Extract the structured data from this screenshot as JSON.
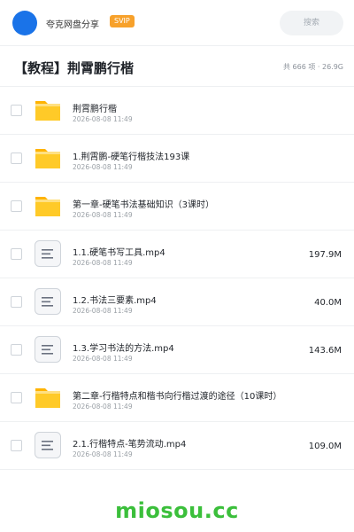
{
  "header": {
    "user_name": "夸克网盘分享",
    "badge": "SVIP",
    "search_placeholder": "搜索",
    "avatar_color": "#1a73e8"
  },
  "folder": {
    "title": "【教程】荆霄鹏行楷",
    "stats": "共 666 项 · 26.9G"
  },
  "files": [
    {
      "type": "folder",
      "icon": "folder-icon",
      "name": "荆霄鹏行楷",
      "date": "2026-08-08 11:49",
      "size": ""
    },
    {
      "type": "folder",
      "icon": "folder-icon",
      "name": "1.荆霄鹏-硬笔行楷技法193课",
      "date": "2026-08-08 11:49",
      "size": ""
    },
    {
      "type": "folder",
      "icon": "folder-icon",
      "name": "第一章-硬笔书法基础知识（3课时）",
      "date": "2026-08-08 11:49",
      "size": ""
    },
    {
      "type": "file",
      "icon": "video-file-icon",
      "name": "1.1.硬笔书写工具.mp4",
      "date": "2026-08-08 11:49",
      "size": "197.9M"
    },
    {
      "type": "file",
      "icon": "video-file-icon",
      "name": "1.2.书法三要素.mp4",
      "date": "2026-08-08 11:49",
      "size": "40.0M"
    },
    {
      "type": "file",
      "icon": "video-file-icon",
      "name": "1.3.学习书法的方法.mp4",
      "date": "2026-08-08 11:49",
      "size": "143.6M"
    },
    {
      "type": "folder",
      "icon": "folder-icon",
      "name": "第二章-行楷特点和楷书向行楷过渡的途径（10课时）",
      "date": "2026-08-08 11:49",
      "size": ""
    },
    {
      "type": "file",
      "icon": "video-file-icon",
      "name": "2.1.行楷特点-笔势流动.mp4",
      "date": "2026-08-08 11:49",
      "size": "109.0M"
    }
  ],
  "watermark": "miosou.cc",
  "colors": {
    "accent": "#1a73e8",
    "folder": "#ffc107",
    "badge": "#f7a12b",
    "watermark": "#3bbf3b"
  }
}
